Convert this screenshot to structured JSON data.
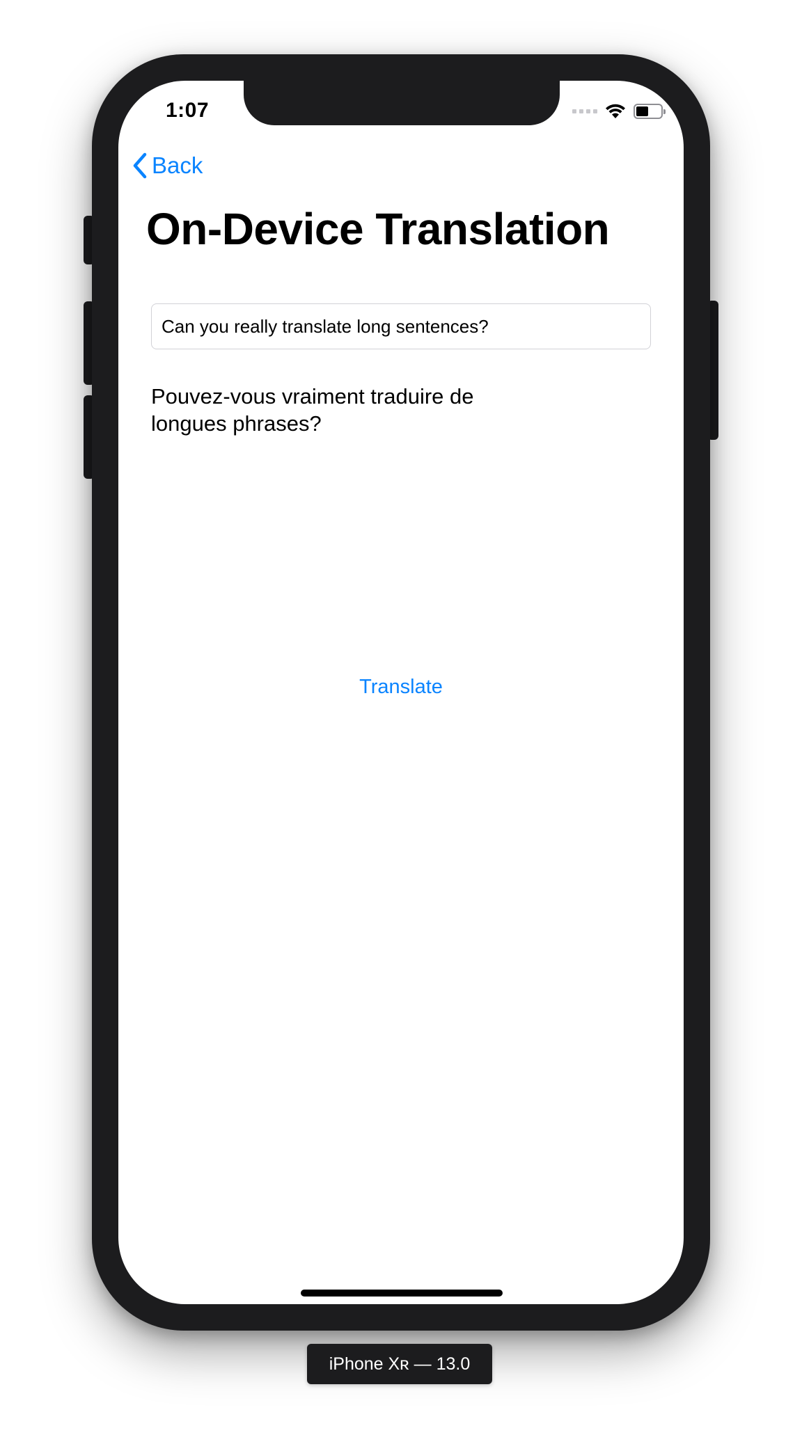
{
  "status_bar": {
    "time": "1:07",
    "battery_level": 0.5
  },
  "nav": {
    "back_label": "Back",
    "title": "On-Device Translation"
  },
  "input": {
    "value": "Can you really translate long sentences?"
  },
  "output": {
    "translated_text": "Pouvez-vous vraiment traduire de longues phrases?"
  },
  "actions": {
    "translate_label": "Translate"
  },
  "simulator": {
    "device_label": "iPhone Xʀ — 13.0"
  },
  "colors": {
    "accent": "#0a84ff",
    "frame": "#1c1c1e"
  },
  "icons": {
    "back": "chevron-left-icon",
    "wifi": "wifi-icon",
    "battery": "battery-icon",
    "signal": "cellular-signal-icon"
  }
}
